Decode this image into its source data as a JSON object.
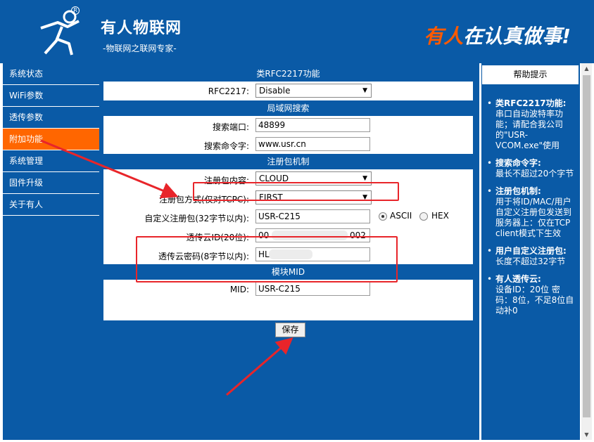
{
  "header": {
    "brand_title": "有人物联网",
    "brand_subtitle": "-物联网之联网专家-",
    "reg_mark": "R",
    "slogan_accent": "有人",
    "slogan_rest": "在认真做事!",
    "bg_color": "#0a5aa6"
  },
  "sidebar": {
    "items": [
      {
        "label": "系统状态"
      },
      {
        "label": "WiFi参数"
      },
      {
        "label": "透传参数"
      },
      {
        "label": "附加功能"
      },
      {
        "label": "系统管理"
      },
      {
        "label": "固件升级"
      },
      {
        "label": "关于有人"
      }
    ],
    "active_index": 3,
    "active_color": "#ff6600"
  },
  "main": {
    "sections": {
      "rfc": {
        "title": "类RFC2217功能",
        "label": "RFC2217:",
        "value": "Disable"
      },
      "lan": {
        "title": "局域网搜索",
        "port_label": "搜索端口:",
        "port_value": "48899",
        "cmd_label": "搜索命令字:",
        "cmd_value": "www.usr.cn"
      },
      "reg": {
        "title": "注册包机制",
        "content_label": "注册包内容:",
        "content_value": "CLOUD",
        "mode_label": "注册包方式(仅对TCPC):",
        "mode_value": "FIRST",
        "custom_label": "自定义注册包(32字节以内):",
        "custom_value": "USR-C215",
        "ascii_label": "ASCII",
        "hex_label": "HEX",
        "cloud_id_label": "透传云ID(20位):",
        "cloud_id_prefix": "00",
        "cloud_id_suffix": "002",
        "cloud_pwd_label": "透传云密码(8字节以内):",
        "cloud_pwd_prefix": "HL"
      },
      "mid": {
        "title": "模块MID",
        "label": "MID:",
        "value": "USR-C215"
      }
    },
    "save_label": "保存"
  },
  "help": {
    "title": "帮助提示",
    "items": [
      {
        "head": "类RFC2217功能:",
        "body": "串口自动波特率功能；请配合我公司的\"USR-VCOM.exe\"使用"
      },
      {
        "head": "搜索命令字:",
        "body": "最长不超过20个字节"
      },
      {
        "head": "注册包机制:",
        "body": "用于将ID/MAC/用户自定义注册包发送到服务器上：仅在TCP client模式下生效"
      },
      {
        "head": "用户自定义注册包:",
        "body": "长度不超过32字节"
      },
      {
        "head": "有人透传云:",
        "body": "设备ID：20位 密码：8位，不足8位自动补0"
      }
    ]
  },
  "annotation_color": "#e8252a"
}
